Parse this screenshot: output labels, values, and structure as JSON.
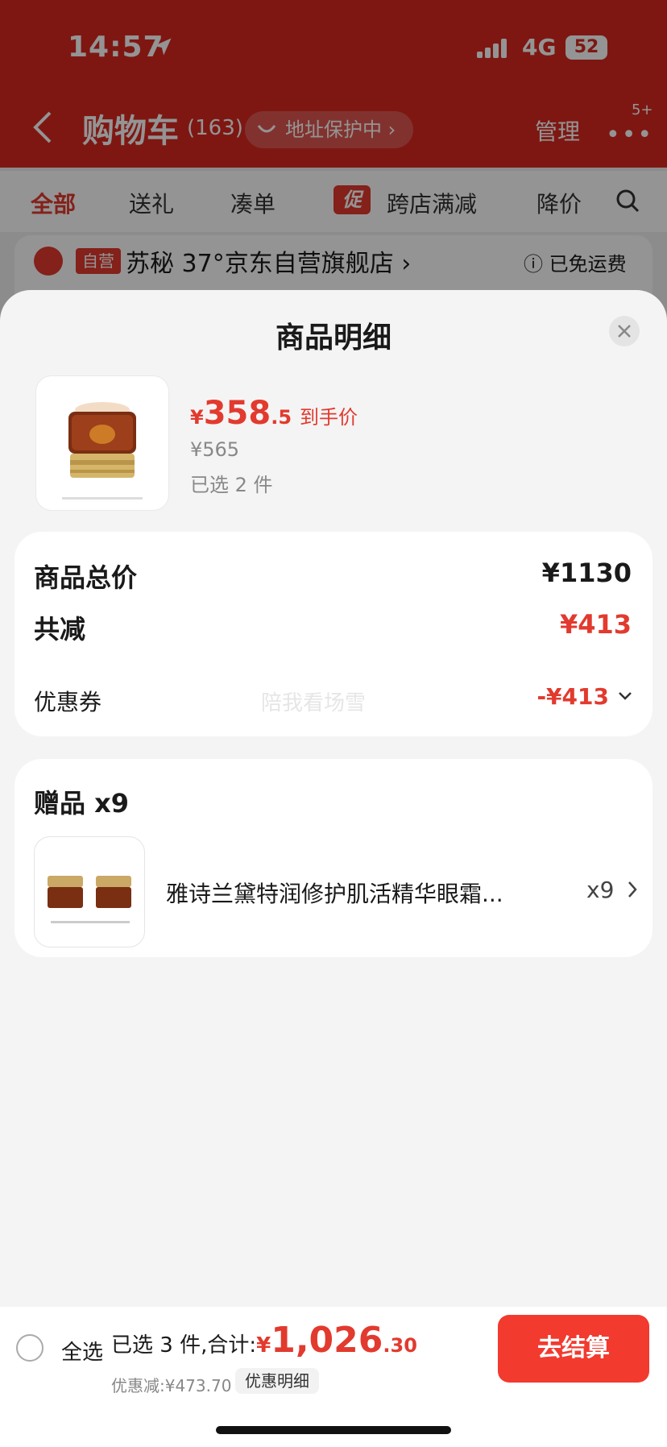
{
  "status_bar": {
    "time": "14:57",
    "network": "4G",
    "battery": "52"
  },
  "nav": {
    "title": "购物车",
    "count": "(163)",
    "protect": "地址保护中 ›",
    "manage": "管理",
    "more": "•••",
    "badge": "5+"
  },
  "tabs": {
    "items": [
      "全部",
      "送礼",
      "凑单",
      "跨店满减",
      "降价"
    ],
    "promo_badge": "促"
  },
  "store": {
    "self_tag": "自营",
    "name": "苏秘 37°京东自营旗舰店 ›",
    "shipping": "ⓘ 已免运费"
  },
  "sheet": {
    "title": "商品明细",
    "product": {
      "yen": "¥",
      "price_int": "358",
      "price_dec": ".5",
      "price_tag": "到手价",
      "original_price": "¥565",
      "selected": "已选 2 件"
    },
    "summary": {
      "total_label": "商品总价",
      "total_value": "¥1130",
      "reduce_label": "共减",
      "reduce_value": "¥413",
      "coupon_label": "优惠券",
      "coupon_value": "-¥413",
      "watermark": "陪我看场雪"
    },
    "gift": {
      "title": "赠品 x9",
      "name": "雅诗兰黛特润修护肌活精华眼霜...",
      "qty": "x9"
    }
  },
  "bottom": {
    "select_all": "全选",
    "total_prefix": "已选 3 件,合计:",
    "yen": "¥",
    "total_int": "1,026",
    "total_dec": ".30",
    "discount": "优惠减:¥473.70",
    "detail": "优惠明细",
    "checkout": "去结算"
  },
  "colors": {
    "accent": "#e23a2e",
    "header_red": "#d9281f"
  }
}
